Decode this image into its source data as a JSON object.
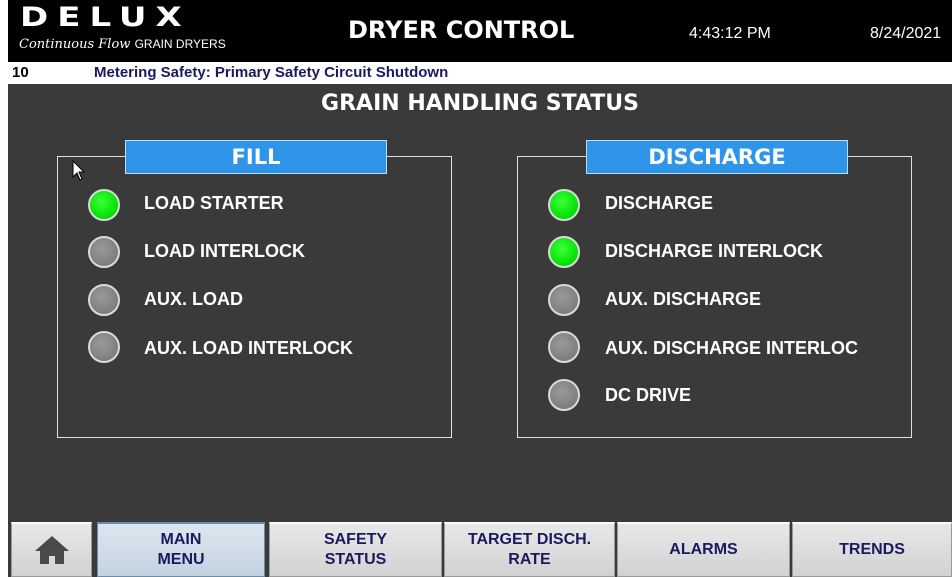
{
  "header": {
    "logo": "DELUX",
    "tagline_script": "Continuous Flow",
    "tagline_caps": "GRAIN DRYERS",
    "title": "DRYER CONTROL",
    "time": "4:43:12 PM",
    "date": "8/24/2021"
  },
  "alarm": {
    "code": "10",
    "message": "Metering Safety: Primary Safety Circuit Shutdown"
  },
  "page_title": "GRAIN HANDLING STATUS",
  "fill": {
    "label": "FILL",
    "items": [
      {
        "label": "LOAD STARTER",
        "on": true
      },
      {
        "label": "LOAD INTERLOCK",
        "on": false
      },
      {
        "label": "AUX. LOAD",
        "on": false
      },
      {
        "label": "AUX. LOAD INTERLOCK",
        "on": false
      }
    ]
  },
  "discharge": {
    "label": "DISCHARGE",
    "items": [
      {
        "label": "DISCHARGE",
        "on": true
      },
      {
        "label": "DISCHARGE INTERLOCK",
        "on": true
      },
      {
        "label": "AUX. DISCHARGE",
        "on": false
      },
      {
        "label": "AUX. DISCHARGE INTERLOC",
        "on": false
      },
      {
        "label": "DC DRIVE",
        "on": false
      }
    ]
  },
  "nav": {
    "home_icon": "home-icon",
    "main_menu": [
      "MAIN",
      "MENU"
    ],
    "safety_status": [
      "SAFETY",
      "STATUS"
    ],
    "target_disch_rate": [
      "TARGET DISCH.",
      "RATE"
    ],
    "alarms": "ALARMS",
    "trends": "TRENDS"
  },
  "colors": {
    "indicator_on": "#00e000",
    "indicator_off": "#8a8a8a",
    "panel_label": "#2e95e8",
    "background": "#3a3a3a"
  }
}
